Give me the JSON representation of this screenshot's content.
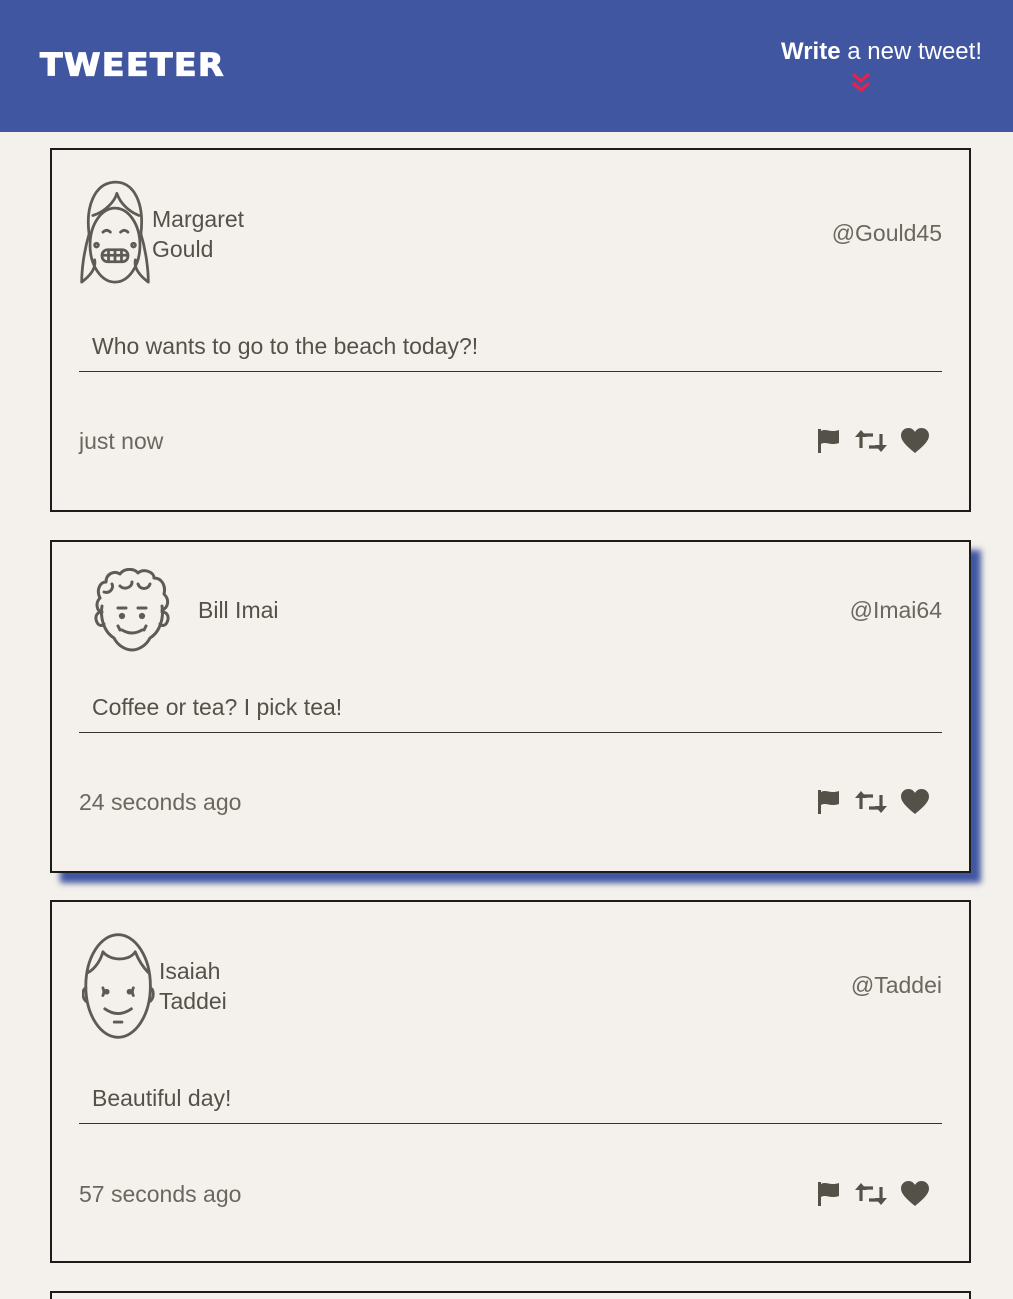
{
  "header": {
    "brand": "TWEETER",
    "compose_strong": "Write",
    "compose_rest": " a new tweet!"
  },
  "colors": {
    "nav_bg": "#4056a1",
    "page_bg": "#f4f1ec",
    "accent_chevron": "#e8214a",
    "hover_shadow": "#4056a1",
    "icon": "#545149"
  },
  "tweets": [
    {
      "name_line1": "Margaret",
      "name_line2": "Gould",
      "handle": "@Gould45",
      "content": "Who wants to go to the beach today?!",
      "time": "just now",
      "avatar_icon": "girl-avatar-icon"
    },
    {
      "name_line1": "Bill Imai",
      "name_line2": "",
      "handle": "@Imai64",
      "content": "Coffee or tea? I pick tea!",
      "time": "24 seconds ago",
      "avatar_icon": "curly-hair-avatar-icon"
    },
    {
      "name_line1": "Isaiah",
      "name_line2": "Taddei",
      "handle": "@Taddei",
      "content": "Beautiful day!",
      "time": "57 seconds ago",
      "avatar_icon": "bald-man-avatar-icon"
    }
  ],
  "action_icons": [
    "flag-icon",
    "retweet-icon",
    "heart-icon"
  ]
}
